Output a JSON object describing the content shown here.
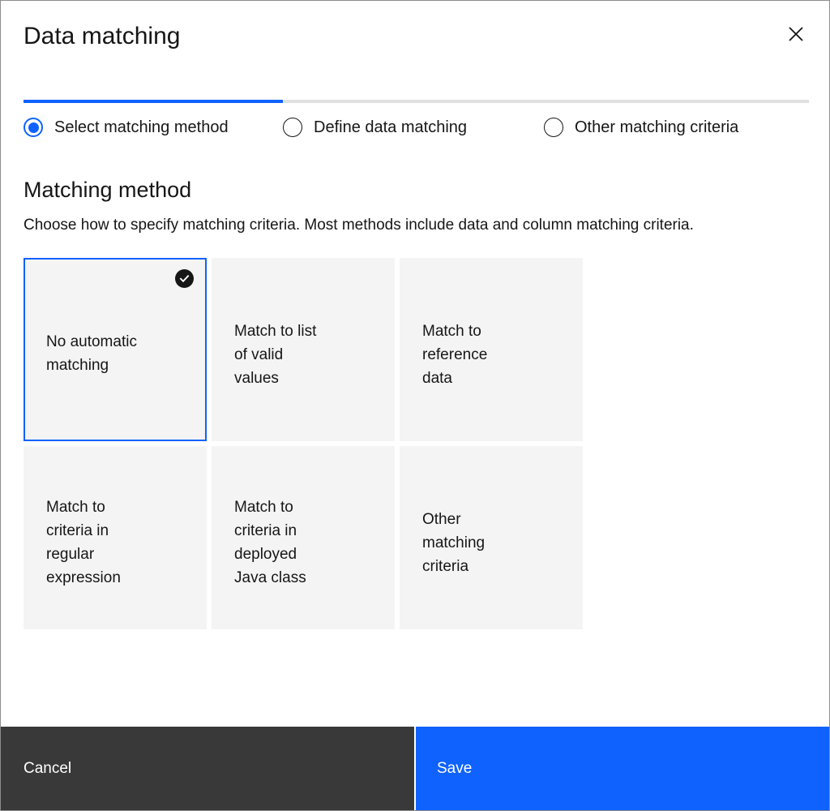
{
  "modal": {
    "title": "Data matching",
    "close_icon": "close-icon"
  },
  "progress": {
    "fill_percent": 33,
    "accent_color": "#0f62fe",
    "track_color": "#e0e0e0"
  },
  "steps": [
    {
      "label": "Select matching method",
      "selected": true
    },
    {
      "label": "Define data matching",
      "selected": false
    },
    {
      "label": "Other matching criteria",
      "selected": false
    }
  ],
  "section": {
    "title": "Matching method",
    "description": "Choose how to specify matching criteria. Most methods include data and column matching criteria."
  },
  "cards": [
    {
      "label": "No automatic matching",
      "selected": true
    },
    {
      "label": "Match to list of valid values",
      "selected": false
    },
    {
      "label": "Match to reference data",
      "selected": false
    },
    {
      "label": "Match to criteria in regular expression",
      "selected": false
    },
    {
      "label": "Match to criteria in deployed Java class",
      "selected": false
    },
    {
      "label": "Other matching criteria",
      "selected": false
    }
  ],
  "footer": {
    "cancel_label": "Cancel",
    "save_label": "Save",
    "cancel_color": "#393939",
    "save_color": "#0f62fe"
  }
}
